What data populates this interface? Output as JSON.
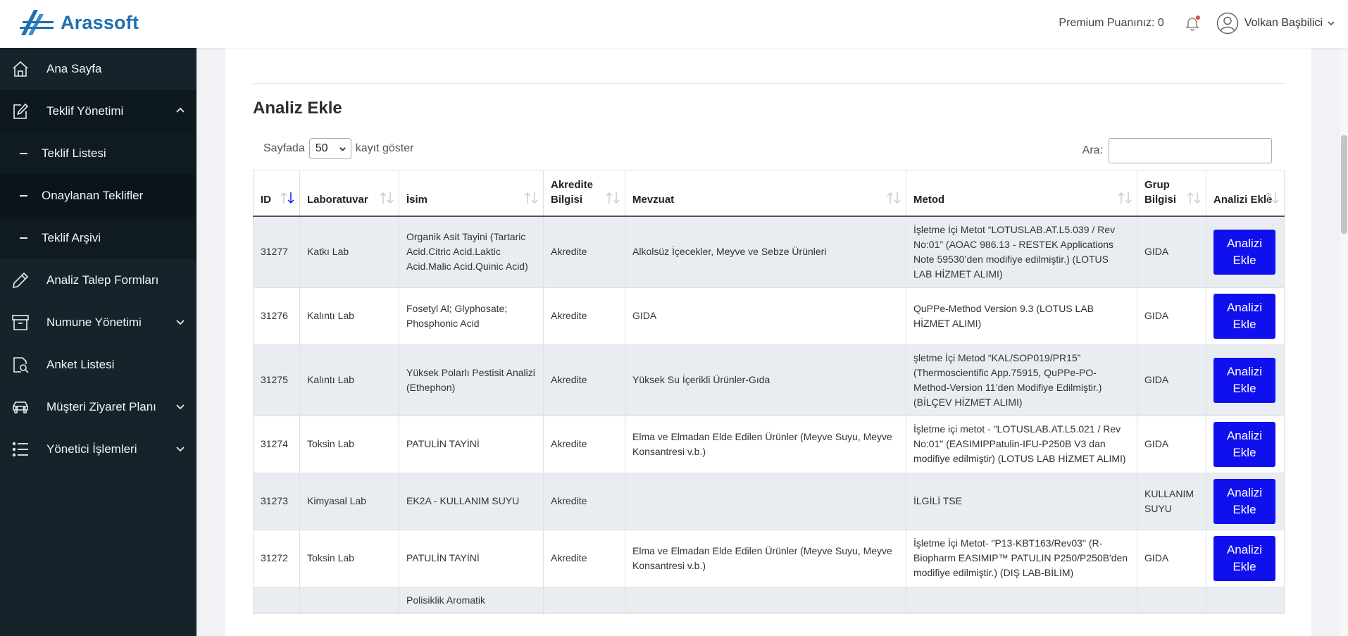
{
  "brand": {
    "name": "Arassoft"
  },
  "header": {
    "premium_label": "Premium Puanınız: 0",
    "user_name": "Volkan Başbilici"
  },
  "sidebar": {
    "items": [
      {
        "label": "Ana Sayfa",
        "icon": "home-icon"
      },
      {
        "label": "Teklif Yönetimi",
        "icon": "edit-icon",
        "expanded": true,
        "children": [
          {
            "label": "Teklif Listesi"
          },
          {
            "label": "Onaylanan Teklifler"
          },
          {
            "label": "Teklif Arşivi"
          }
        ]
      },
      {
        "label": "Analiz Talep Formları",
        "icon": "pencil-icon"
      },
      {
        "label": "Numune Yönetimi",
        "icon": "archive-box-icon"
      },
      {
        "label": "Anket Listesi",
        "icon": "document-search-icon"
      },
      {
        "label": "Müşteri Ziyaret Planı",
        "icon": "car-icon"
      },
      {
        "label": "Yönetici İşlemleri",
        "icon": "list-icon"
      }
    ]
  },
  "main": {
    "title": "Analiz Ekle",
    "length_prefix": "Sayfada",
    "length_value": "50",
    "length_suffix": "kayıt göster",
    "search_label": "Ara:",
    "search_value": "",
    "columns": [
      "ID",
      "Laboratuvar",
      "İsim",
      "Akredite Bilgisi",
      "Mevzuat",
      "Metod",
      "Grup Bilgisi",
      "Analizi Ekle"
    ],
    "button_label": "Analizi Ekle",
    "rows": [
      {
        "id": "31277",
        "lab": "Katkı Lab",
        "name": "Organik Asit Tayini (Tartaric Acid.Citric Acid.Laktic Acid.Malic Acid.Quinic Acid)",
        "accredit": "Akredite",
        "regulation": "Alkolsüz İçecekler, Meyve ve Sebze Ürünleri",
        "method": "İşletme İçi Metot “LOTUSLAB.AT.L5.039 / Rev No:01” (AOAC 986.13 - RESTEK Applications Note 59530’den modifiye edilmiştir.) (LOTUS LAB HİZMET ALIMI)",
        "group": "GIDA"
      },
      {
        "id": "31276",
        "lab": "Kalıntı Lab",
        "name": "Fosetyl Al; Glyphosate; Phosphonic Acid",
        "accredit": "Akredite",
        "regulation": "GIDA",
        "method": "QuPPe-Method Version 9.3 (LOTUS LAB HİZMET ALIMI)",
        "group": "GIDA"
      },
      {
        "id": "31275",
        "lab": "Kalıntı Lab",
        "name": "Yüksek Polarlı Pestisit Analizi (Ethephon)",
        "accredit": "Akredite",
        "regulation": "Yüksek Su İçerikli Ürünler-Gıda",
        "method": "şletme İçi Metod “KAL/SOP019/PR15” (Thermoscientific App.75915, QuPPe-PO-Method-Version 11’den Modifiye Edilmiştir.) (BİLÇEV HİZMET ALIMI)",
        "group": "GIDA"
      },
      {
        "id": "31274",
        "lab": "Toksin Lab",
        "name": "PATULİN TAYİNİ",
        "accredit": "Akredite",
        "regulation": "Elma ve Elmadan Elde Edilen Ürünler (Meyve Suyu, Meyve Konsantresi v.b.)",
        "method": "İşletme içi metot - \"LOTUSLAB.AT.L5.021 / Rev No:01\" (EASIMIPPatulin-IFU-P250B V3 dan modifiye edilmiştir) (LOTUS LAB HİZMET ALIMI)",
        "group": "GIDA"
      },
      {
        "id": "31273",
        "lab": "Kimyasal Lab",
        "name": "EK2A - KULLANIM SUYU",
        "accredit": "Akredite",
        "regulation": "",
        "method": "İLGİLİ TSE",
        "group": "KULLANIM SUYU"
      },
      {
        "id": "31272",
        "lab": "Toksin Lab",
        "name": "PATULİN TAYİNİ",
        "accredit": "Akredite",
        "regulation": "Elma ve Elmadan Elde Edilen Ürünler (Meyve Suyu, Meyve Konsantresi v.b.)",
        "method": "İşletme İçi Metot- \"P13-KBT163/Rev03\" (R-Biopharm EASIMIP™ PATULIN P250/P250B'den modifiye edilmiştir.) (DIŞ LAB-BİLİM)",
        "group": "GIDA"
      },
      {
        "id": "",
        "lab": "",
        "name": "Polisiklik Aromatik",
        "accredit": "",
        "regulation": "",
        "method": "",
        "group": ""
      }
    ]
  }
}
